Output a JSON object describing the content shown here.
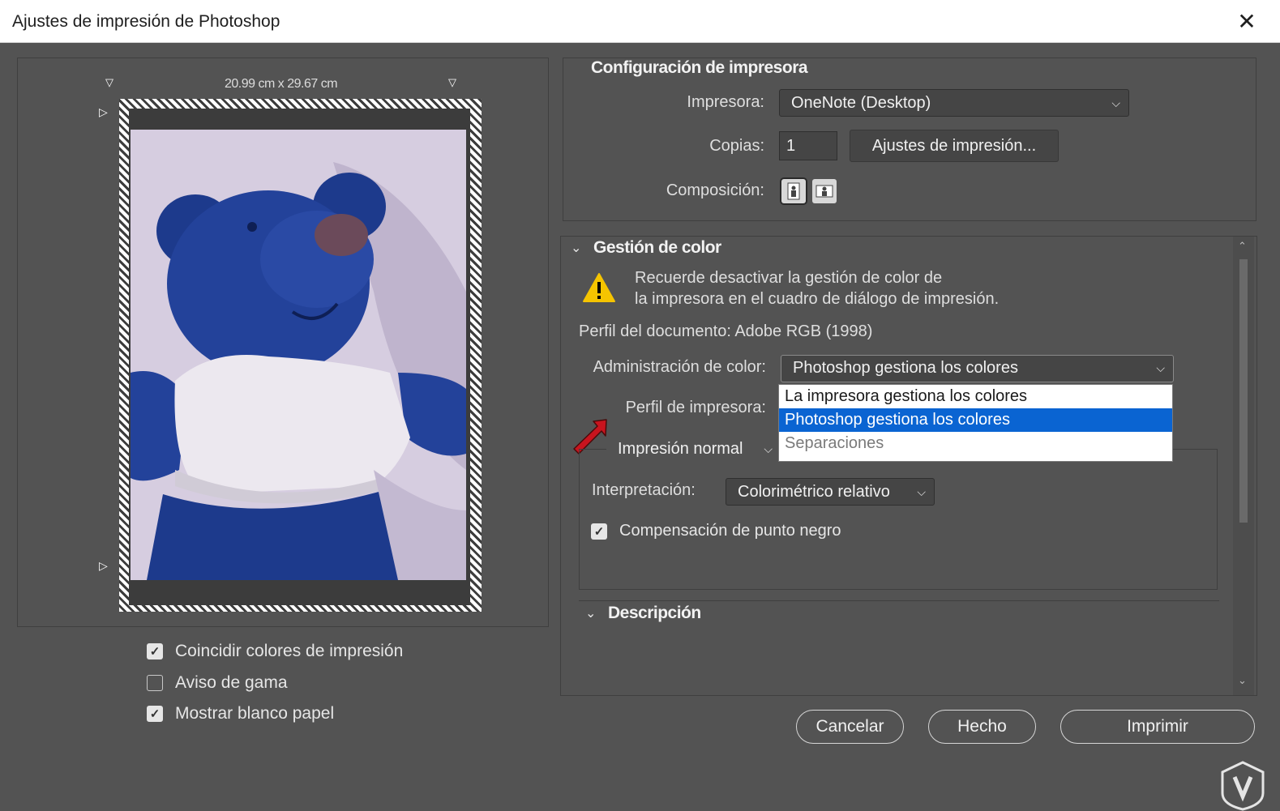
{
  "window": {
    "title": "Ajustes de impresión de Photoshop",
    "close_glyph": "✕"
  },
  "preview": {
    "dimensions": "20.99 cm x 29.67 cm",
    "checkboxes": [
      {
        "label": "Coincidir colores de impresión",
        "checked": true
      },
      {
        "label": "Aviso de gama",
        "checked": false
      },
      {
        "label": "Mostrar blanco papel",
        "checked": true
      }
    ]
  },
  "printer_setup": {
    "title": "Configuración de impresora",
    "printer_label": "Impresora:",
    "printer_value": "OneNote (Desktop)",
    "copies_label": "Copias:",
    "copies_value": "1",
    "print_settings_button": "Ajustes de impresión...",
    "layout_label": "Composición:",
    "layout_icons": [
      "portrait-layout-icon",
      "landscape-layout-icon"
    ]
  },
  "color_management": {
    "title": "Gestión de color",
    "warning_line1": "Recuerde desactivar la gestión de color de",
    "warning_line2": "la impresora en el cuadro de diálogo de impresión.",
    "document_profile": "Perfil del documento: Adobe RGB (1998)",
    "color_handling_label": "Administración de color:",
    "color_handling_value": "Photoshop gestiona los colores",
    "printer_profile_label": "Perfil de impresora:",
    "print_mode_value": "Impresión normal",
    "rendering_label": "Interpretación:",
    "rendering_value": "Colorimétrico relativo",
    "bpc_label": "Compensación de punto negro",
    "bpc_checked": true,
    "description_title": "Descripción",
    "dropdown_options": [
      {
        "label": "La impresora gestiona los colores",
        "state": "normal"
      },
      {
        "label": "Photoshop gestiona los colores",
        "state": "selected"
      },
      {
        "label": "Separaciones",
        "state": "disabled"
      }
    ]
  },
  "buttons": {
    "cancel": "Cancelar",
    "done": "Hecho",
    "print": "Imprimir"
  },
  "colors": {
    "dialog_bg": "#535353",
    "accent_selected": "#0a64d2",
    "arrow_red": "#c8141e",
    "warning_yellow": "#f5c400"
  }
}
